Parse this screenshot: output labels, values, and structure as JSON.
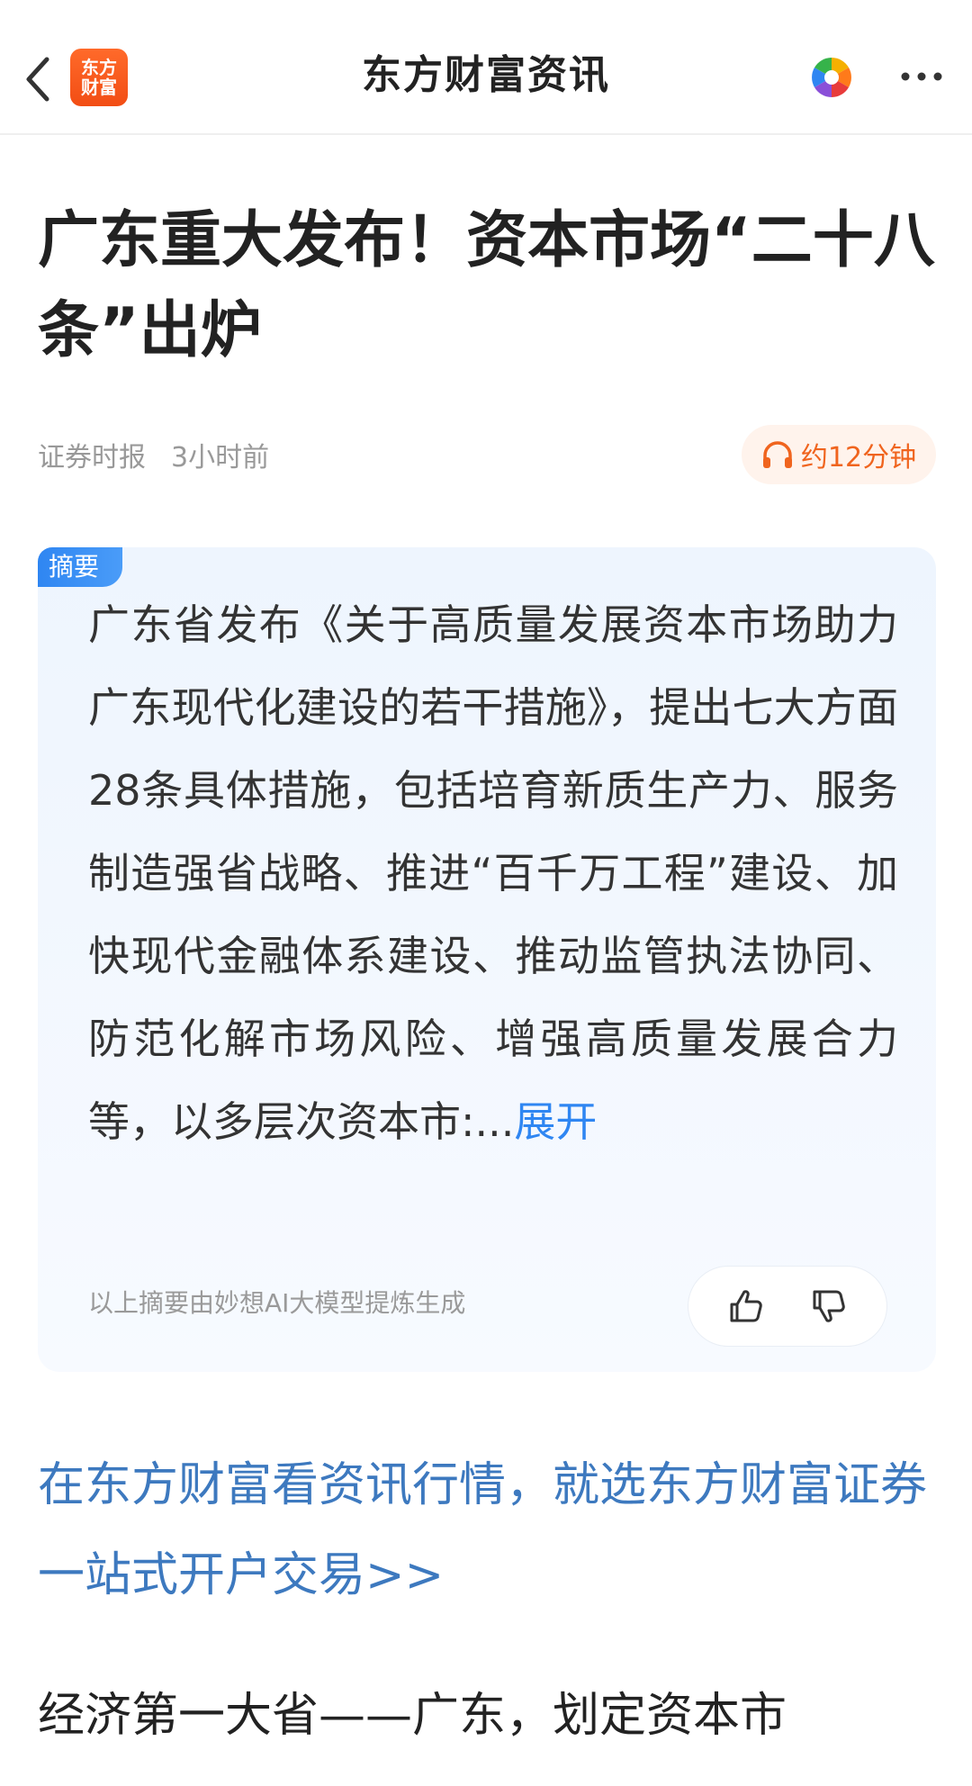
{
  "header": {
    "title": "东方财富资讯",
    "logo_line1": "东方",
    "logo_line2": "财富"
  },
  "article": {
    "title": "广东重大发布！资本市场“二十八条”出炉",
    "source": "证券时报",
    "time": "3小时前",
    "listen_label": "约12分钟"
  },
  "summary": {
    "tag": "摘要",
    "text": "广东省发布《关于高质量发展资本市场助力广东现代化建设的若干措施》，提出七大方面28条具体措施，包括培育新质生产力、服务制造强省战略、推进“百千万工程”建设、加快现代金融体系建设、推动监管执法协同、防范化解市场风险、增强高质量发展合力等，以多层次资本市:...",
    "expand_label": "展开",
    "note": "以上摘要由妙想AI大模型提炼生成"
  },
  "promo": {
    "text": "在东方财富看资讯行情，就选东方财富证券一站式开户交易>>"
  },
  "body": {
    "paragraph_start": "经济第一大省——广东，划定资本市"
  },
  "colors": {
    "accent_orange": "#f0641e",
    "link_blue": "#3d79bf",
    "summary_blue": "#2f86f2"
  }
}
